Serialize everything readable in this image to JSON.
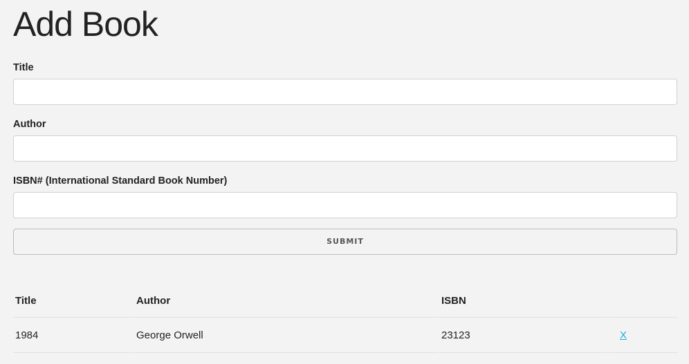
{
  "page": {
    "title": "Add Book"
  },
  "form": {
    "title_label": "Title",
    "title_value": "",
    "author_label": "Author",
    "author_value": "",
    "isbn_label": "ISBN# (International Standard Book Number)",
    "isbn_value": "",
    "submit_label": "SUBMIT"
  },
  "table": {
    "headers": [
      "Title",
      "Author",
      "ISBN",
      ""
    ],
    "rows": [
      {
        "title": "1984",
        "author": "George Orwell",
        "isbn": "23123",
        "delete_label": "X"
      }
    ]
  },
  "colors": {
    "background": "#f3f3f3",
    "link": "#1eaedb",
    "text": "#222222"
  }
}
